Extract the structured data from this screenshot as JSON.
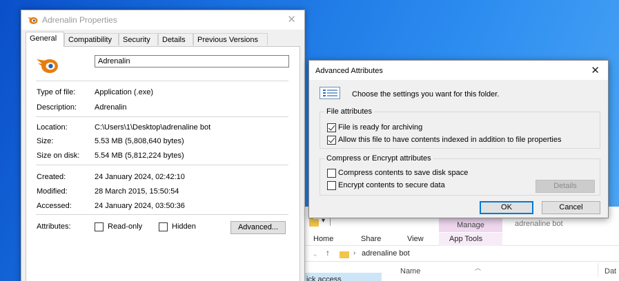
{
  "explorer": {
    "manage_tab": "Manage",
    "title": "adrenaline bot",
    "ribbon_tabs": [
      "Home",
      "Share",
      "View",
      "App Tools"
    ],
    "path_chevron": "›",
    "path": "adrenaline bot",
    "nav_pane_item": "ick access",
    "columns": {
      "name": "Name",
      "date": "Dat"
    }
  },
  "properties": {
    "title": "Adrenalin Properties",
    "close_glyph": "✕",
    "tabs": [
      "General",
      "Compatibility",
      "Security",
      "Details",
      "Previous Versions"
    ],
    "active_tab": "General",
    "file_name": "Adrenalin",
    "fields": {
      "type_label": "Type of file:",
      "type_value": "Application (.exe)",
      "description_label": "Description:",
      "description_value": "Adrenalin",
      "location_label": "Location:",
      "location_value": "C:\\Users\\1\\Desktop\\adrenaline bot",
      "size_label": "Size:",
      "size_value": "5.53 MB (5,808,640 bytes)",
      "size_on_disk_label": "Size on disk:",
      "size_on_disk_value": "5.54 MB (5,812,224 bytes)",
      "created_label": "Created:",
      "created_value": "24 January 2024, 02:42:10",
      "modified_label": "Modified:",
      "modified_value": "28 March 2015, 15:50:54",
      "accessed_label": "Accessed:",
      "accessed_value": "24 January 2024, 03:50:36",
      "attributes_label": "Attributes:"
    },
    "attributes": {
      "readonly_label": "Read-only",
      "readonly_checked": false,
      "hidden_label": "Hidden",
      "hidden_checked": false,
      "advanced_button": "Advanced..."
    }
  },
  "advanced": {
    "title": "Advanced Attributes",
    "close_glyph": "✕",
    "description": "Choose the settings you want for this folder.",
    "file_attributes": {
      "group_title": "File attributes",
      "archive_label": "File is ready for archiving",
      "archive_checked": true,
      "index_label": "Allow this file to have contents indexed in addition to file properties",
      "index_checked": true
    },
    "compress_encrypt": {
      "group_title": "Compress or Encrypt attributes",
      "compress_label": "Compress contents to save disk space",
      "compress_checked": false,
      "encrypt_label": "Encrypt contents to secure data",
      "encrypt_checked": false,
      "details_button": "Details"
    },
    "ok_button": "OK",
    "cancel_button": "Cancel"
  },
  "colors": {
    "desktop_accent": "#1b74e2",
    "manage_tab": "#efd7ef",
    "default_button_border": "#0078d7",
    "folder_yellow": "#f3c54b"
  },
  "icons": [
    "blender-app-icon",
    "folder-icon",
    "settings-list-icon",
    "close-icon",
    "up-arrow-icon"
  ]
}
